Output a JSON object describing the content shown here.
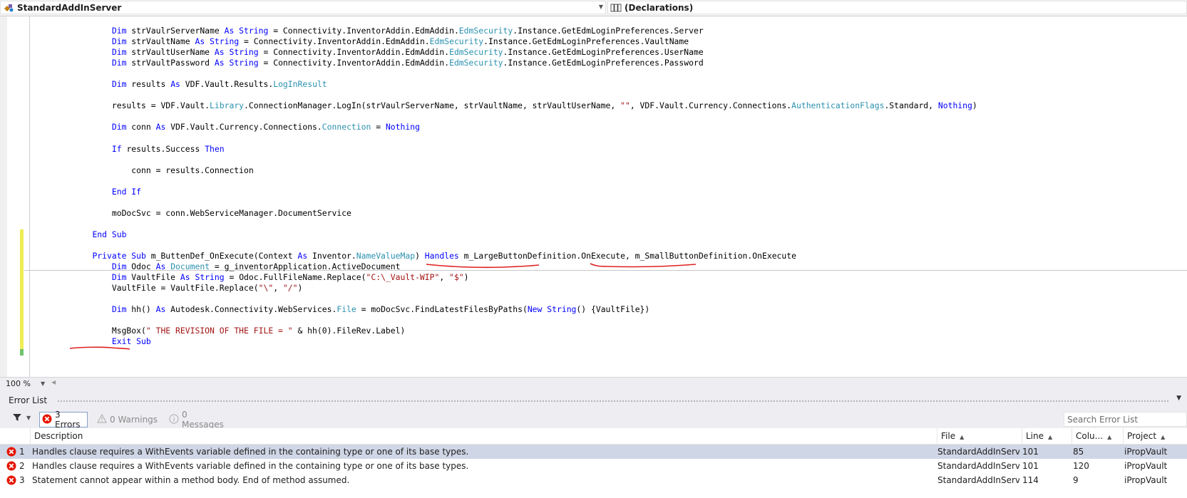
{
  "navbar": {
    "class_combo": "StandardAddInServer",
    "member_combo": "(Declarations)"
  },
  "code": {
    "lines": [
      [
        [
          "",
          "        "
        ],
        [
          "kw",
          "Dim"
        ],
        [
          "",
          " strVaulrServerName "
        ],
        [
          "kw",
          "As String"
        ],
        [
          "",
          " = Connectivity.InventorAddin.EdmAddin."
        ],
        [
          "ty",
          "EdmSecurity"
        ],
        [
          "",
          ".Instance.GetEdmLoginPreferences.Server"
        ]
      ],
      [
        [
          "",
          "        "
        ],
        [
          "kw",
          "Dim"
        ],
        [
          "",
          " strVaultName "
        ],
        [
          "kw",
          "As String"
        ],
        [
          "",
          " = Connectivity.InventorAddin.EdmAddin."
        ],
        [
          "ty",
          "EdmSecurity"
        ],
        [
          "",
          ".Instance.GetEdmLoginPreferences.VaultName"
        ]
      ],
      [
        [
          "",
          "        "
        ],
        [
          "kw",
          "Dim"
        ],
        [
          "",
          " strVaultUserName "
        ],
        [
          "kw",
          "As String"
        ],
        [
          "",
          " = Connectivity.InventorAddin.EdmAddin."
        ],
        [
          "ty",
          "EdmSecurity"
        ],
        [
          "",
          ".Instance.GetEdmLoginPreferences.UserName"
        ]
      ],
      [
        [
          "",
          "        "
        ],
        [
          "kw",
          "Dim"
        ],
        [
          "",
          " strVaultPassword "
        ],
        [
          "kw",
          "As String"
        ],
        [
          "",
          " = Connectivity.InventorAddin.EdmAddin."
        ],
        [
          "ty",
          "EdmSecurity"
        ],
        [
          "",
          ".Instance.GetEdmLoginPreferences.Password"
        ]
      ],
      [],
      [
        [
          "",
          "        "
        ],
        [
          "kw",
          "Dim"
        ],
        [
          "",
          " results "
        ],
        [
          "kw",
          "As"
        ],
        [
          "",
          " VDF.Vault.Results."
        ],
        [
          "ty",
          "LogInResult"
        ]
      ],
      [],
      [
        [
          "",
          "        results = VDF.Vault."
        ],
        [
          "ty",
          "Library"
        ],
        [
          "",
          ".ConnectionManager.LogIn(strVaulrServerName, strVaultName, strVaultUserName, "
        ],
        [
          "st",
          "\"\""
        ],
        [
          "",
          ", VDF.Vault.Currency.Connections."
        ],
        [
          "ty",
          "AuthenticationFlags"
        ],
        [
          "",
          ".Standard, "
        ],
        [
          "kw",
          "Nothing"
        ],
        [
          "",
          ")"
        ]
      ],
      [],
      [
        [
          "",
          "        "
        ],
        [
          "kw",
          "Dim"
        ],
        [
          "",
          " conn "
        ],
        [
          "kw",
          "As"
        ],
        [
          "",
          " VDF.Vault.Currency.Connections."
        ],
        [
          "ty",
          "Connection"
        ],
        [
          "",
          " = "
        ],
        [
          "kw",
          "Nothing"
        ]
      ],
      [],
      [
        [
          "",
          "        "
        ],
        [
          "kw",
          "If"
        ],
        [
          "",
          " results.Success "
        ],
        [
          "kw",
          "Then"
        ]
      ],
      [],
      [
        [
          "",
          "            conn = results.Connection"
        ]
      ],
      [],
      [
        [
          "",
          "        "
        ],
        [
          "kw",
          "End If"
        ]
      ],
      [],
      [
        [
          "",
          "        moDocSvc = conn.WebServiceManager.DocumentService"
        ]
      ],
      [],
      [
        [
          "",
          "    "
        ],
        [
          "kw",
          "End Sub"
        ]
      ],
      [],
      [
        [
          "",
          "    "
        ],
        [
          "kw",
          "Private Sub"
        ],
        [
          "",
          " m_ButtenDef_OnExecute(Context "
        ],
        [
          "kw",
          "As"
        ],
        [
          "",
          " Inventor."
        ],
        [
          "ty",
          "NameValueMap"
        ],
        [
          "",
          ") "
        ],
        [
          "kw",
          "Handles"
        ],
        [
          "",
          " m_LargeButtonDefinition.OnExecute, m_SmallButtonDefinition.OnExecute"
        ]
      ],
      [
        [
          "",
          "        "
        ],
        [
          "kw",
          "Dim"
        ],
        [
          "",
          " Odoc "
        ],
        [
          "kw",
          "As"
        ],
        [
          "",
          " "
        ],
        [
          "ty",
          "Document"
        ],
        [
          "",
          " = g_inventorApplication.ActiveDocument"
        ]
      ],
      [
        [
          "",
          "        "
        ],
        [
          "kw",
          "Dim"
        ],
        [
          "",
          " VaultFile "
        ],
        [
          "kw",
          "As String"
        ],
        [
          "",
          " = Odoc.FullFileName.Replace("
        ],
        [
          "st",
          "\"C:\\_Vault-WIP\""
        ],
        [
          "",
          ", "
        ],
        [
          "st",
          "\"$\""
        ],
        [
          "",
          ")"
        ]
      ],
      [
        [
          "",
          "        VaultFile = VaultFile.Replace("
        ],
        [
          "st",
          "\"\\\""
        ],
        [
          "",
          ", "
        ],
        [
          "st",
          "\"/\""
        ],
        [
          "",
          ")"
        ]
      ],
      [],
      [
        [
          "",
          "        "
        ],
        [
          "kw",
          "Dim"
        ],
        [
          "",
          " hh() "
        ],
        [
          "kw",
          "As"
        ],
        [
          "",
          " Autodesk.Connectivity.WebServices."
        ],
        [
          "ty",
          "File"
        ],
        [
          "",
          " = moDocSvc.FindLatestFilesByPaths("
        ],
        [
          "kw",
          "New String"
        ],
        [
          "",
          "() {VaultFile})"
        ]
      ],
      [],
      [
        [
          "",
          "        MsgBox("
        ],
        [
          "st",
          "\" THE REVISION OF THE FILE = \""
        ],
        [
          "",
          " & hh(0).FileRev.Label)"
        ]
      ],
      [
        [
          "",
          "        "
        ],
        [
          "kw",
          "Exit Sub"
        ]
      ]
    ]
  },
  "zoom": "100 %",
  "error_list": {
    "title": "Error List",
    "errors_btn": "3 Errors",
    "warnings_btn": "0 Warnings",
    "messages_btn": "0 Messages",
    "search_placeholder": "Search Error List",
    "columns": {
      "description": "Description",
      "file": "File",
      "line": "Line",
      "column": "Colu...",
      "project": "Project"
    },
    "rows": [
      {
        "num": "1",
        "description": "Handles clause requires a WithEvents variable defined in the containing type or one of its base types.",
        "file": "StandardAddInServer.vb",
        "line": "101",
        "column": "85",
        "project": "iPropVault"
      },
      {
        "num": "2",
        "description": "Handles clause requires a WithEvents variable defined in the containing type or one of its base types.",
        "file": "StandardAddInServer.vb",
        "line": "101",
        "column": "120",
        "project": "iPropVault"
      },
      {
        "num": "3",
        "description": "Statement cannot appear within a method body. End of method assumed.",
        "file": "StandardAddInServer.vb",
        "line": "114",
        "column": "9",
        "project": "iPropVault"
      }
    ]
  },
  "colors": {
    "keyword": "#0000ff",
    "type": "#2b91af",
    "string": "#a31515",
    "annotation": "#e02020",
    "change_yellow": "#eeee55",
    "change_green": "#6ec36e",
    "error_red": "#e51400"
  }
}
